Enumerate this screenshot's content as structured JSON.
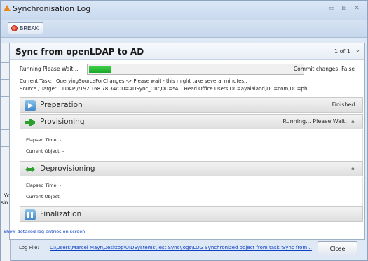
{
  "window": {
    "title": "Synchronisation Log",
    "controls": {
      "minimize": "▭",
      "maximize": "⊞",
      "close": "✕"
    }
  },
  "toolbar": {
    "break_label": "BREAK"
  },
  "background": {
    "frag_1": "Yo",
    "frag_2": "sin"
  },
  "panel": {
    "title": "Sync from openLDAP to AD",
    "page_indicator": "1 of 1",
    "collapse_glyph": "»",
    "running_text": "Running Please Wait...",
    "progress": 0.1,
    "commit_text": "Commit changes: False",
    "current_task_label": "Current Task:",
    "current_task_value": "QueryingSourceForChanges -> Please wait - this might take several minutes..",
    "source_target_label": "Source / Target:",
    "source_target_value": "LDAP://192.168.78.34/OU=ADSync_Out,OU=*ALI  Head  Office  Users,DC=ayalaland,DC=com,DC=ph"
  },
  "steps": {
    "preparation": {
      "title": "Preparation",
      "status": "Finished."
    },
    "provisioning": {
      "title": "Provisioning",
      "status": "Running... Please Wait.",
      "chevron": "»",
      "elapsed_label": "Elapsed Time:",
      "elapsed_value": "-",
      "object_label": "Current Object:",
      "object_value": "-"
    },
    "deprovisioning": {
      "title": "Deprovisioning",
      "chevron": "»",
      "elapsed_label": "Elapsed Time:",
      "elapsed_value": "-",
      "object_label": "Current Object:",
      "object_value": "-"
    },
    "finalization": {
      "title": "Finalization"
    }
  },
  "footer": {
    "detail_link": "Show detailed log entries on screen",
    "logfile_label": "Log File:",
    "logfile_path": "C:\\Users\\Marcel Mayr\\Desktop\\UIDSystems\\Test Sync\\logs\\LOG Synchronized object from task 'Sync from...",
    "close_label": "Close"
  },
  "colors": {
    "progress_green": "#22b533",
    "link_blue": "#0b3fc4",
    "title_icon": "#e8891e",
    "break_red": "#d8321a"
  }
}
